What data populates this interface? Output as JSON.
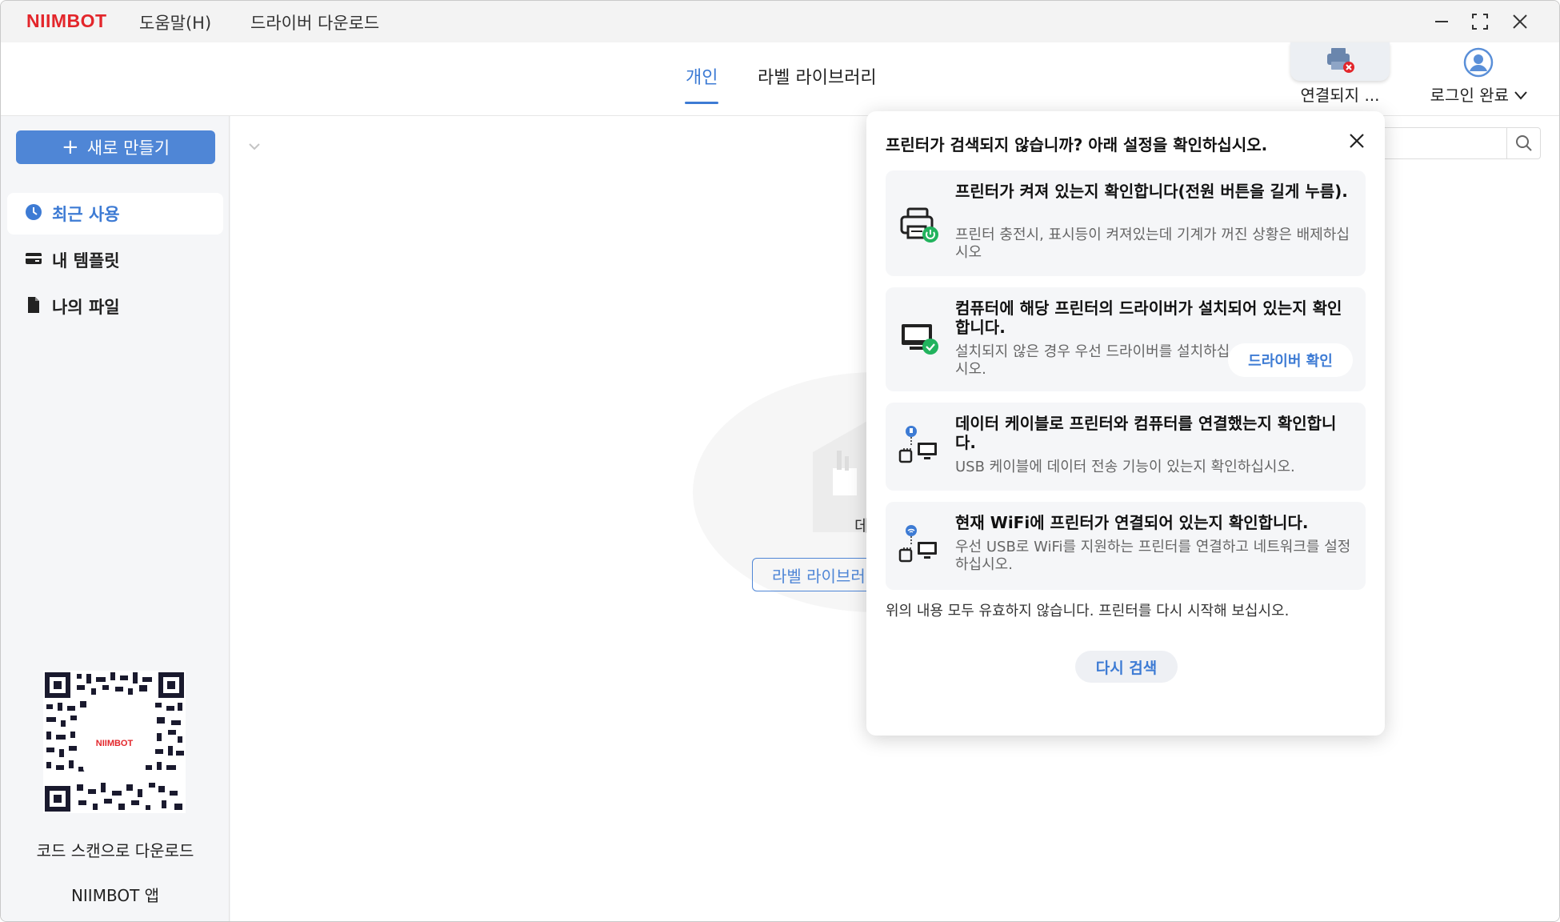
{
  "app": {
    "logo": "NIIMBOT",
    "menu": {
      "help": "도움말(H)",
      "driver_download": "드라이버 다운로드"
    }
  },
  "header": {
    "tabs": [
      {
        "label": "개인",
        "active": true
      },
      {
        "label": "라벨 라이브러리",
        "active": false
      }
    ],
    "printer_status": "연결되지 ...",
    "login_label": "로그인 완료"
  },
  "sidebar": {
    "new_button": "새로 만들기",
    "items": [
      {
        "label": "최근 사용",
        "icon": "clock-icon",
        "active": true
      },
      {
        "label": "내 템플릿",
        "icon": "wallet-icon",
        "active": false
      },
      {
        "label": "나의 파일",
        "icon": "file-icon",
        "active": false
      }
    ],
    "qr_logo": "NIIMBOT",
    "qr_caption": "코드 스캔으로 다운로드",
    "app_name": "NIIMBOT 앱"
  },
  "main": {
    "empty_text": "데",
    "library_button": "라벨 라이브러"
  },
  "popup": {
    "title": "프린터가 검색되지 않습니까? 아래 설정을 확인하십시오.",
    "cards": [
      {
        "icon": "printer-power-icon",
        "title": "프린터가 켜져 있는지 확인합니다(전원 버튼을 길게 누름).",
        "desc": "프린터 충전시, 표시등이 켜져있는데 기계가 꺼진 상황은 배제하십시오"
      },
      {
        "icon": "monitor-check-icon",
        "title": "컴퓨터에 해당 프린터의 드라이버가 설치되어 있는지 확인합니다.",
        "desc": "설치되지 않은 경우 우선 드라이버를 설치하십시오.",
        "button": "드라이버 확인"
      },
      {
        "icon": "usb-connection-icon",
        "title": "데이터 케이블로 프린터와 컴퓨터를 연결했는지 확인합니다.",
        "desc": "USB 케이블에 데이터 전송 기능이 있는지 확인하십시오."
      },
      {
        "icon": "wifi-connection-icon",
        "title": "현재 WiFi에 프린터가 연결되어 있는지 확인합니다.",
        "desc": "우선 USB로 WiFi를 지원하는 프린터를 연결하고 네트워크를 설정하십시오."
      }
    ],
    "footer": "위의 내용 모두 유효하지 않습니다. 프린터를 다시 시작해 보십시오.",
    "retry_button": "다시 검색"
  },
  "colors": {
    "brand": "#e3262b",
    "accent": "#3d7bd4",
    "primary_button": "#4f86d6",
    "success": "#22b35e"
  }
}
